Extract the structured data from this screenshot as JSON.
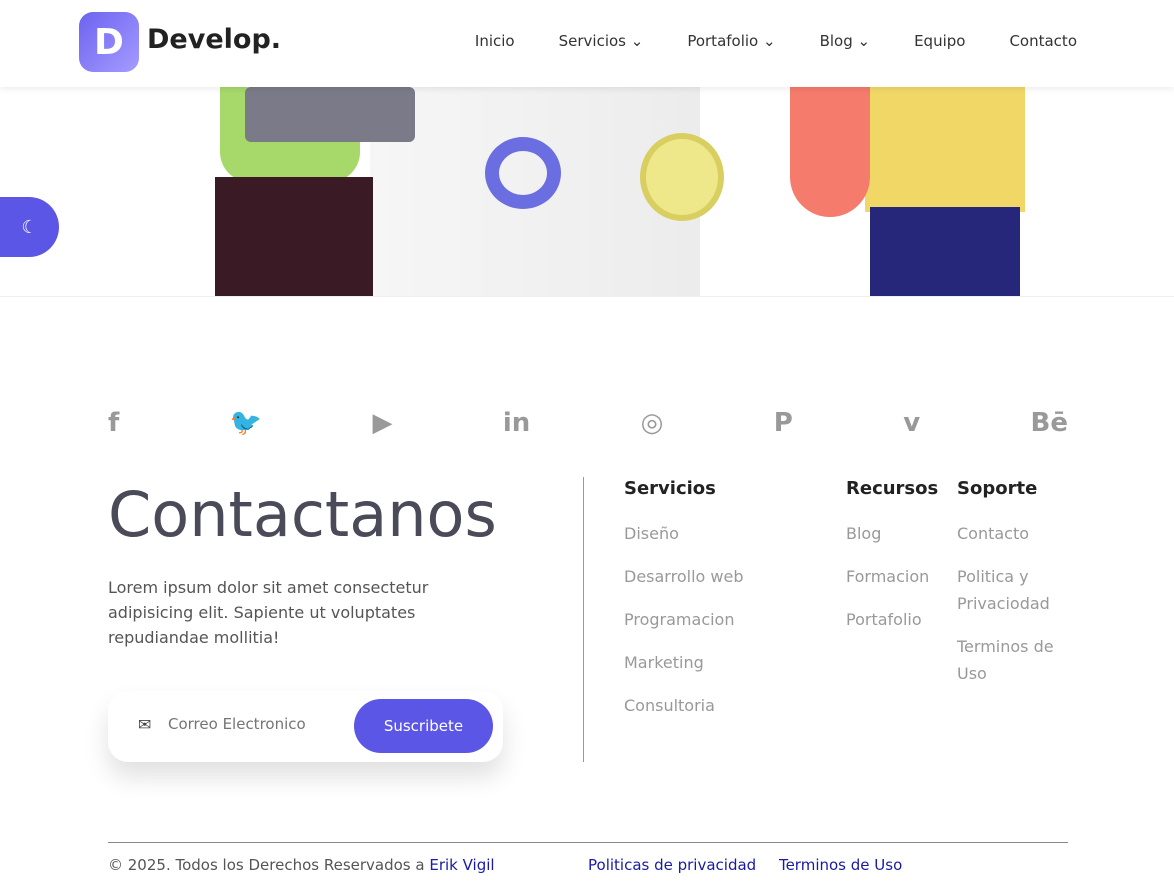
{
  "header": {
    "logo_letter": "D",
    "logo_text": "Develop.",
    "nav": [
      "Inicio",
      "Servicios ⌄",
      "Portafolio ⌄",
      "Blog ⌄",
      "Equipo",
      "Contacto"
    ]
  },
  "social": [
    "f",
    "🐦",
    "▶",
    "in",
    "◎",
    "P",
    "v",
    "Bē"
  ],
  "contact": {
    "title": "Contactanos",
    "description": "Lorem ipsum dolor sit amet consectetur adipisicing elit. Sapiente ut voluptates repudiandae mollitia!",
    "email_placeholder": "Correo Electronico",
    "subscribe": "Suscribete"
  },
  "columns": [
    {
      "title": "Servicios",
      "items": [
        "Diseño",
        "Desarrollo web",
        "Programacion",
        "Marketing",
        "Consultoria"
      ]
    },
    {
      "title": "Recursos",
      "items": [
        "Blog",
        "Formacion",
        "Portafolio"
      ]
    },
    {
      "title": "Soporte",
      "items": [
        "Contacto",
        "Politica y Privaciodad",
        "Terminos de Uso"
      ]
    }
  ],
  "footer": {
    "copyright": "© 2025. Todos los Derechos Reservados a ",
    "author": "Erik Vigil",
    "privacy": "Politicas de privacidad",
    "terms": "Terminos de Uso"
  }
}
